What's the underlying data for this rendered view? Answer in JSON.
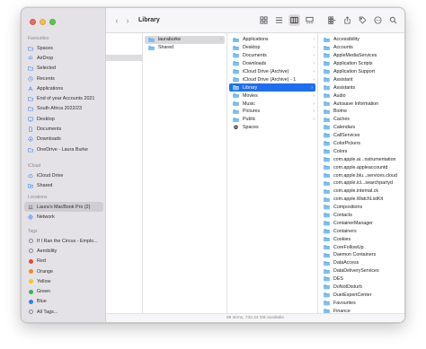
{
  "window": {
    "title": "Library"
  },
  "sidebar": {
    "sections": [
      {
        "heading": "Favourites",
        "items": [
          {
            "label": "Spaces",
            "icon": "folder-icon"
          },
          {
            "label": "AirDrop",
            "icon": "airdrop-icon"
          },
          {
            "label": "Selected",
            "icon": "folder-icon"
          },
          {
            "label": "Recents",
            "icon": "clock-icon"
          },
          {
            "label": "Applications",
            "icon": "applications-icon"
          },
          {
            "label": "End of year Accounts 2021",
            "icon": "folder-icon"
          },
          {
            "label": "South Africa 2022/23",
            "icon": "folder-icon"
          },
          {
            "label": "Desktop",
            "icon": "desktop-icon"
          },
          {
            "label": "Documents",
            "icon": "document-icon"
          },
          {
            "label": "Downloads",
            "icon": "download-icon"
          },
          {
            "label": "OneDrive - Laura Burke",
            "icon": "folder-icon"
          }
        ]
      },
      {
        "heading": "iCloud",
        "items": [
          {
            "label": "iCloud Drive",
            "icon": "cloud-icon"
          },
          {
            "label": "Shared",
            "icon": "shared-folder-icon"
          }
        ]
      },
      {
        "heading": "Locations",
        "items": [
          {
            "label": "Laura's MacBook Pro (2)",
            "icon": "laptop-icon",
            "selected": true
          },
          {
            "label": "Network",
            "icon": "globe-icon"
          }
        ]
      },
      {
        "heading": "Tags",
        "items": [
          {
            "label": "If I Ran the Circus - Emplo...",
            "icon": "tag-ring-icon",
            "color": ""
          },
          {
            "label": "Aerobility",
            "icon": "tag-ring-icon",
            "color": ""
          },
          {
            "label": "Red",
            "icon": "tag-dot-icon",
            "color": "#e8443a"
          },
          {
            "label": "Orange",
            "icon": "tag-dot-icon",
            "color": "#f08a24"
          },
          {
            "label": "Yellow",
            "icon": "tag-dot-icon",
            "color": "#f4c51f"
          },
          {
            "label": "Green",
            "icon": "tag-dot-icon",
            "color": "#3cb54a"
          },
          {
            "label": "Blue",
            "icon": "tag-dot-icon",
            "color": "#2f7ff0"
          },
          {
            "label": "All Tags...",
            "icon": "tag-ring-icon",
            "color": ""
          }
        ]
      }
    ]
  },
  "columns": {
    "col2": [
      {
        "label": "lauraburke",
        "state": "gray",
        "chevron": true
      },
      {
        "label": "Shared",
        "state": "",
        "chevron": false
      }
    ],
    "col3": [
      {
        "label": "Applications",
        "chevron": true
      },
      {
        "label": "Desktop",
        "chevron": true
      },
      {
        "label": "Documents",
        "chevron": true
      },
      {
        "label": "Downloads",
        "chevron": true
      },
      {
        "label": "iCloud Drive (Archive)",
        "chevron": true
      },
      {
        "label": "iCloud Drive (Archive) - 1",
        "chevron": true
      },
      {
        "label": "Library",
        "chevron": true,
        "state": "blue"
      },
      {
        "label": "Movies",
        "chevron": true
      },
      {
        "label": "Music",
        "chevron": true
      },
      {
        "label": "Pictures",
        "chevron": true
      },
      {
        "label": "Public",
        "chevron": true
      },
      {
        "label": "Spaces",
        "chevron": false,
        "icon": "spaces-app-icon"
      }
    ],
    "col4": [
      "Accessibility",
      "Accounts",
      "AppleMediaServices",
      "Application Scripts",
      "Application Support",
      "Assistant",
      "Assistants",
      "Audio",
      "Autosave Information",
      "Biome",
      "Caches",
      "Calendars",
      "CallServices",
      "ColorPickers",
      "Colors",
      "com.apple.ai...nstrumentation",
      "com.apple.appleaccountd",
      "com.apple.blu...services.cloud",
      "com.apple.icl...searchpartyd",
      "com.apple.internal.ck",
      "com.apple.WatchListKit",
      "Compositions",
      "Contacts",
      "ContainerManager",
      "Containers",
      "Cookies",
      "CoreFollowUp",
      "Daemon Containers",
      "DataAccess",
      "DataDeliveryServices",
      "DES",
      "DoNotDisturb",
      "DuetExpertCenter",
      "Favourites",
      "Finance"
    ]
  },
  "status": {
    "text": "98 items, 732.34 GB available"
  },
  "colors": {
    "accent": "#1e6ff0",
    "folder": "#5aa9e6"
  }
}
